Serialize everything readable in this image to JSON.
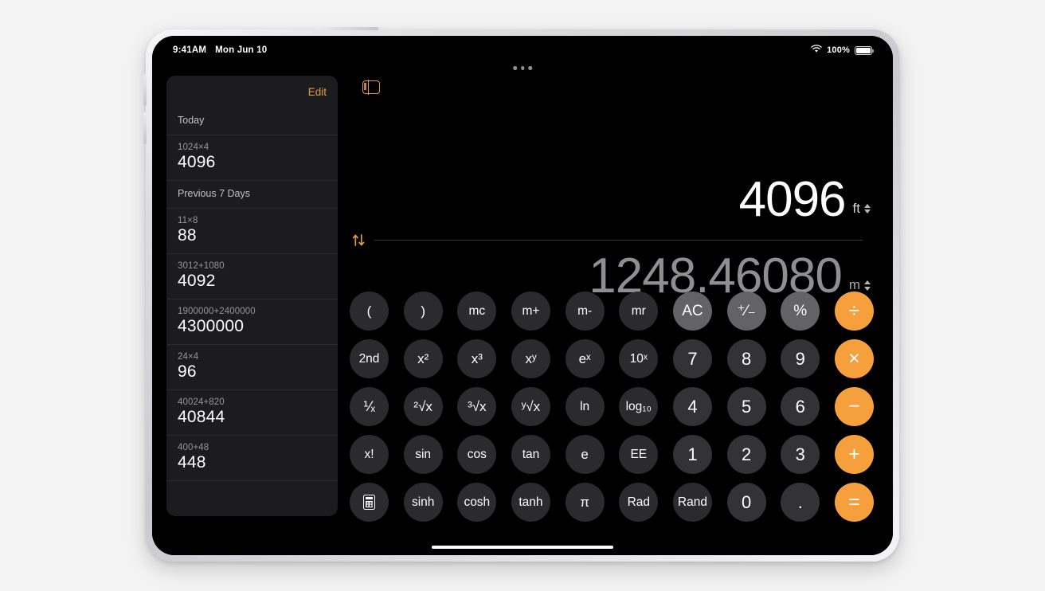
{
  "status_bar": {
    "time": "9:41AM",
    "date": "Mon Jun 10",
    "wifi_icon": "wifi-icon",
    "battery_percent": "100%",
    "battery_icon": "battery-full-icon"
  },
  "sidebar": {
    "edit_label": "Edit",
    "toggle_icon": "sidebar-toggle-icon",
    "sections": [
      {
        "title": "Today",
        "items": [
          {
            "expression": "1024×4",
            "result": "4096"
          }
        ]
      },
      {
        "title": "Previous 7 Days",
        "items": [
          {
            "expression": "11×8",
            "result": "88"
          },
          {
            "expression": "3012+1080",
            "result": "4092"
          },
          {
            "expression": "1900000+2400000",
            "result": "4300000"
          },
          {
            "expression": "24×4",
            "result": "96"
          },
          {
            "expression": "40024+820",
            "result": "40844"
          },
          {
            "expression": "400+48",
            "result": "448"
          }
        ]
      }
    ]
  },
  "converter": {
    "top_value": "4096",
    "top_unit": "ft",
    "bottom_value": "1248.46080",
    "bottom_unit": "m",
    "swap_icon": "swap-vertical-icon"
  },
  "keypad": {
    "rows": [
      [
        {
          "label": "(",
          "name": "key-open-paren",
          "style": "fn"
        },
        {
          "label": ")",
          "name": "key-close-paren",
          "style": "fn"
        },
        {
          "label": "mc",
          "name": "key-memory-clear",
          "style": "fn-small"
        },
        {
          "label": "m+",
          "name": "key-memory-add",
          "style": "fn-small"
        },
        {
          "label": "m-",
          "name": "key-memory-subtract",
          "style": "fn-small"
        },
        {
          "label": "mr",
          "name": "key-memory-recall",
          "style": "fn-small"
        },
        {
          "label": "AC",
          "name": "key-all-clear",
          "style": "gray"
        },
        {
          "label": "⁺⁄₋",
          "name": "key-plus-minus",
          "style": "gray"
        },
        {
          "label": "%",
          "name": "key-percent",
          "style": "gray"
        },
        {
          "label": "÷",
          "name": "key-divide",
          "style": "accent"
        }
      ],
      [
        {
          "label": "2nd",
          "name": "key-second-function",
          "style": "fn-small"
        },
        {
          "label": "x²",
          "name": "key-x-squared",
          "style": "fn"
        },
        {
          "label": "x³",
          "name": "key-x-cubed",
          "style": "fn"
        },
        {
          "label": "xʸ",
          "name": "key-x-power-y",
          "style": "fn"
        },
        {
          "label": "eˣ",
          "name": "key-e-power-x",
          "style": "fn"
        },
        {
          "label": "10ˣ",
          "name": "key-ten-power-x",
          "style": "fn-small"
        },
        {
          "label": "7",
          "name": "key-7",
          "style": "digit"
        },
        {
          "label": "8",
          "name": "key-8",
          "style": "digit"
        },
        {
          "label": "9",
          "name": "key-9",
          "style": "digit"
        },
        {
          "label": "×",
          "name": "key-multiply",
          "style": "accent"
        }
      ],
      [
        {
          "label": "⅟ₓ",
          "name": "key-reciprocal",
          "style": "fn"
        },
        {
          "label": "²√x",
          "name": "key-square-root",
          "style": "fn"
        },
        {
          "label": "³√x",
          "name": "key-cube-root",
          "style": "fn"
        },
        {
          "label": "ʸ√x",
          "name": "key-nth-root",
          "style": "fn"
        },
        {
          "label": "ln",
          "name": "key-natural-log",
          "style": "fn-small"
        },
        {
          "label": "log₁₀",
          "name": "key-log-base-10",
          "style": "fn-small"
        },
        {
          "label": "4",
          "name": "key-4",
          "style": "digit"
        },
        {
          "label": "5",
          "name": "key-5",
          "style": "digit"
        },
        {
          "label": "6",
          "name": "key-6",
          "style": "digit"
        },
        {
          "label": "−",
          "name": "key-subtract",
          "style": "accent"
        }
      ],
      [
        {
          "label": "x!",
          "name": "key-factorial",
          "style": "fn-small"
        },
        {
          "label": "sin",
          "name": "key-sine",
          "style": "fn-small"
        },
        {
          "label": "cos",
          "name": "key-cosine",
          "style": "fn-small"
        },
        {
          "label": "tan",
          "name": "key-tangent",
          "style": "fn-small"
        },
        {
          "label": "e",
          "name": "key-euler-number",
          "style": "fn"
        },
        {
          "label": "EE",
          "name": "key-exponent-entry",
          "style": "fn-small"
        },
        {
          "label": "1",
          "name": "key-1",
          "style": "digit"
        },
        {
          "label": "2",
          "name": "key-2",
          "style": "digit"
        },
        {
          "label": "3",
          "name": "key-3",
          "style": "digit"
        },
        {
          "label": "+",
          "name": "key-add",
          "style": "accent"
        }
      ],
      [
        {
          "label": "",
          "name": "key-calculator-mode",
          "style": "icon"
        },
        {
          "label": "sinh",
          "name": "key-hyperbolic-sine",
          "style": "fn-small"
        },
        {
          "label": "cosh",
          "name": "key-hyperbolic-cosine",
          "style": "fn-small"
        },
        {
          "label": "tanh",
          "name": "key-hyperbolic-tangent",
          "style": "fn-small"
        },
        {
          "label": "π",
          "name": "key-pi",
          "style": "fn"
        },
        {
          "label": "Rad",
          "name": "key-radians",
          "style": "fn-small"
        },
        {
          "label": "Rand",
          "name": "key-random",
          "style": "fn-small"
        },
        {
          "label": "0",
          "name": "key-0",
          "style": "digit"
        },
        {
          "label": ".",
          "name": "key-decimal-point",
          "style": "digit"
        },
        {
          "label": "=",
          "name": "key-equals",
          "style": "accent"
        }
      ]
    ]
  },
  "colors": {
    "accent_orange": "#f5a03c",
    "edit_orange": "#e09a45",
    "key_dark": "#2b2b2d",
    "key_gray": "#636366",
    "sidebar_bg": "#1c1c1e",
    "screen_bg": "#000000",
    "secondary_text": "#8e8e93"
  }
}
